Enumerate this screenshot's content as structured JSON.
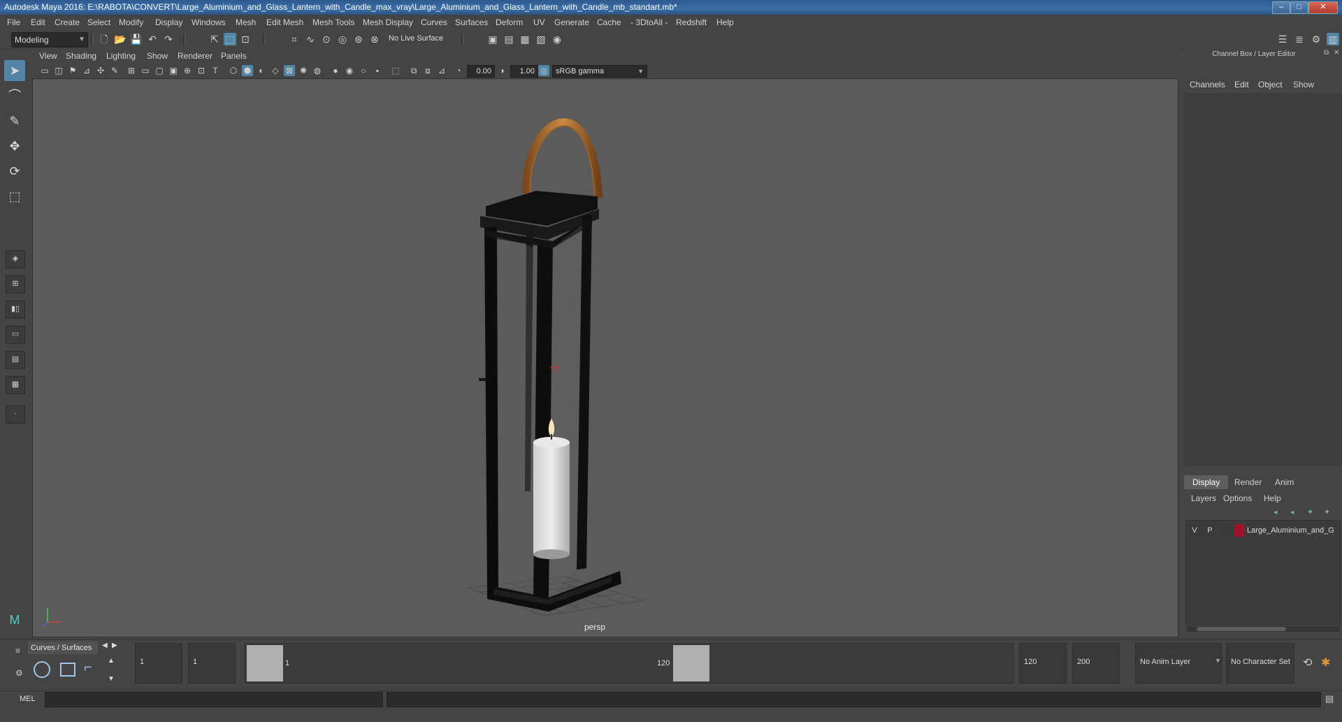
{
  "window": {
    "title": "Autodesk Maya 2016: E:\\RABOTA\\CONVERT\\Large_Aluminium_and_Glass_Lantern_with_Candle_max_vray\\Large_Aluminium_and_Glass_Lantern_with_Candle_mb_standart.mb*",
    "minimize": "–",
    "maximize": "□",
    "close": "✕"
  },
  "menubar": [
    "File",
    "Edit",
    "Create",
    "Select",
    "Modify",
    "Display",
    "Windows",
    "Mesh",
    "Edit Mesh",
    "Mesh Tools",
    "Mesh Display",
    "Curves",
    "Surfaces",
    "Deform",
    "UV",
    "Generate",
    "Cache",
    "- 3DtoAll -",
    "Redshift",
    "Help"
  ],
  "statusline": {
    "mode": "Modeling",
    "live_surface": "No Live Surface"
  },
  "viewport": {
    "menus": [
      "View",
      "Shading",
      "Lighting",
      "Show",
      "Renderer",
      "Panels"
    ],
    "exposure": "0.00",
    "gamma": "1.00",
    "color_space": "sRGB gamma",
    "camera_label": "persp"
  },
  "channel_box": {
    "title": "Channel Box / Layer Editor",
    "menus": [
      "Channels",
      "Edit",
      "Object",
      "Show"
    ]
  },
  "layer_editor": {
    "tabs": [
      "Display",
      "Render",
      "Anim"
    ],
    "active_tab": "Display",
    "menus": [
      "Layers",
      "Options",
      "Help"
    ],
    "layers": [
      {
        "v": "V",
        "p": "P",
        "name": "Large_Aluminium_and_G",
        "color": "#a0122a"
      }
    ]
  },
  "shelf": {
    "tab": "Curves / Surfaces"
  },
  "time": {
    "current_start": "1",
    "current_frame": "1",
    "slider_start": "1",
    "slider_end": "120",
    "range_end": "120",
    "anim_end": "200",
    "anim_layer": "No Anim Layer",
    "character_set": "No Character Set"
  },
  "command": {
    "language": "MEL"
  },
  "colors": {
    "accent": "#5285a6",
    "viewport_bg": "#5b5b5b",
    "layer_color": "#a0122a"
  }
}
